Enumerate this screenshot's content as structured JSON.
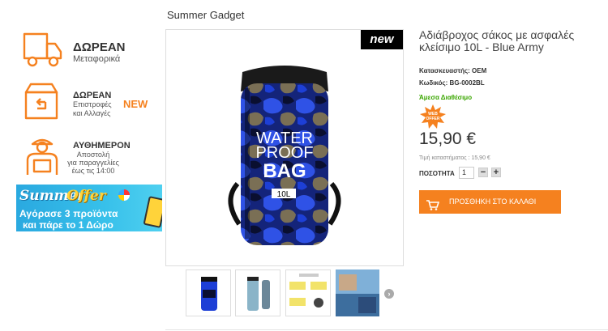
{
  "sidebar": {
    "shipping": {
      "title": "ΔΩΡΕΑΝ",
      "subtitle": "Μεταφορικά"
    },
    "returns": {
      "title": "ΔΩΡΕΑΝ",
      "subtitle_line1": "Επιστροφές",
      "subtitle_line2": "και Αλλαγές",
      "badge": "NEW"
    },
    "delivery": {
      "title": "ΑΥΘΗΜΕΡΟΝ",
      "line1": "Αποστολή",
      "line2": "για παραγγελίες",
      "line3": "έως τις 14:00"
    },
    "banner": {
      "title_part1": "Summer",
      "title_part2": "Offer",
      "line1": "Αγόρασε 3 προϊόντα",
      "line2": "και πάρε το 1 Δώρο"
    }
  },
  "breadcrumb": {
    "category": "Summer Gadget"
  },
  "product": {
    "image_badge": "new",
    "bag_text_line1": "WATER",
    "bag_text_line2": "PROOF",
    "bag_text_line3": "BAG",
    "bag_capacity": "10L",
    "title": "Αδιάβροχος σάκος με ασφαλές κλείσιμο 10L - Blue Army",
    "manufacturer": "Κατασκευαστής: OEM",
    "code": "Κωδικός: BG-0002BL",
    "availability": "Άμεσα Διαθέσιμο",
    "offer_badge_line1": "WEB",
    "offer_badge_line2": "OFFER",
    "price": "15,90 €",
    "store_price": "Τιμή καταστήματος : 15,90 €",
    "quantity_label": "ΠΟΣΟΤΗΤΑ",
    "quantity_value": "1",
    "minus_label": "−",
    "plus_label": "+",
    "add_to_cart_label": "ΠΡΟΣΘΗΚΗ ΣΤΟ ΚΑΛΑΘΙ"
  },
  "thumbnails": {
    "next_icon": "›",
    "items": [
      "bag-front",
      "bag-side",
      "bag-features",
      "bag-lifestyle"
    ]
  },
  "colors": {
    "accent": "#f5811f",
    "available": "#3aa600",
    "bag_blue": "#1d3fd6"
  },
  "icons": [
    "truck-icon",
    "return-box-icon",
    "courier-icon",
    "cart-icon",
    "chevron-right-icon",
    "web-offer-starburst-icon"
  ]
}
